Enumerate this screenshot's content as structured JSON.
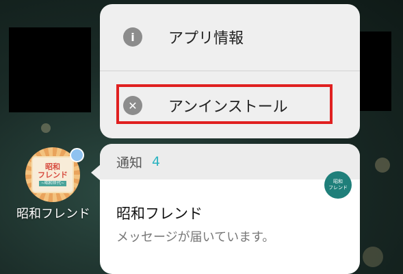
{
  "app": {
    "label": "昭和フレンド",
    "icon_line1": "昭和",
    "icon_line2": "フレンド",
    "icon_line3": "~昭和世代~"
  },
  "menu": {
    "items": [
      {
        "label": "アプリ情報",
        "icon": "info-icon"
      },
      {
        "label": "アンインストール",
        "icon": "close-circle-icon"
      }
    ]
  },
  "notification": {
    "header": "通知",
    "count": "4",
    "app_name": "昭和フレンド",
    "message": "メッセージが届いています。",
    "avatar_line1": "昭和",
    "avatar_line2": "フレンド"
  },
  "colors": {
    "highlight": "#e02020",
    "count_accent": "#2ab3c0",
    "avatar_bg": "#1f7f7a"
  }
}
